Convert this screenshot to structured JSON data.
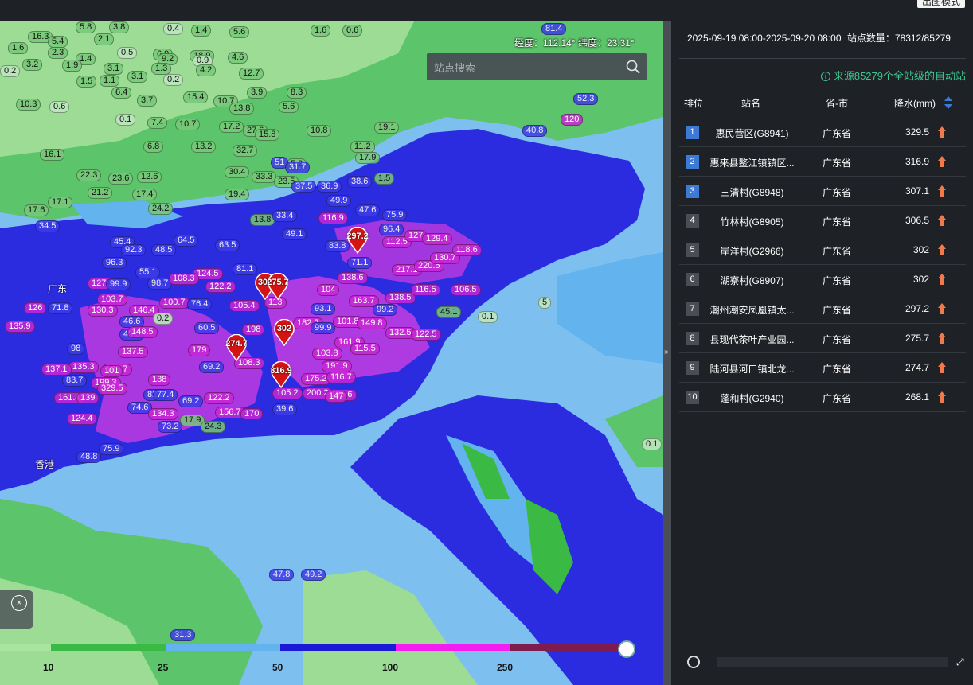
{
  "topbar": {
    "mode_button": "出图模式"
  },
  "map": {
    "coord_readout": "经度：112.14° 纬度：23.31°",
    "search_placeholder": "站点搜索",
    "region_labels": {
      "guangdong": "广东",
      "hongkong": "香港"
    },
    "rain_labels": [
      {
        "t": "5.8",
        "c": "g"
      },
      {
        "t": "3.8",
        "c": "g"
      },
      {
        "t": "0.4",
        "c": "w"
      },
      {
        "t": "1.4",
        "c": "g"
      },
      {
        "t": "5.6",
        "c": "g"
      },
      {
        "t": "1.6",
        "c": "g"
      },
      {
        "t": "0.6",
        "c": "g"
      },
      {
        "t": "16.3",
        "c": "g"
      },
      {
        "t": "5.4",
        "c": "g"
      },
      {
        "t": "2.1",
        "c": "g"
      },
      {
        "t": "1.6",
        "c": "g"
      },
      {
        "t": "2.3",
        "c": "g"
      },
      {
        "t": "0.5",
        "c": "w"
      },
      {
        "t": "6.9",
        "c": "g"
      },
      {
        "t": "18.9",
        "c": "g"
      },
      {
        "t": "4.6",
        "c": "g"
      },
      {
        "t": "3.2",
        "c": "g"
      },
      {
        "t": "1.4",
        "c": "g"
      },
      {
        "t": "9.2",
        "c": "g"
      },
      {
        "t": "0.9",
        "c": "w"
      },
      {
        "t": "3.1",
        "c": "g"
      },
      {
        "t": "1.3",
        "c": "g"
      },
      {
        "t": "4.2",
        "c": "g"
      },
      {
        "t": "12.7",
        "c": "g"
      },
      {
        "t": "0.2",
        "c": "w"
      },
      {
        "t": "1.1",
        "c": "g"
      },
      {
        "t": "3.1",
        "c": "g"
      },
      {
        "t": "1.9",
        "c": "g"
      },
      {
        "t": "1.5",
        "c": "g"
      },
      {
        "t": "0.2",
        "c": "w"
      },
      {
        "t": "6.4",
        "c": "g"
      },
      {
        "t": "3.9",
        "c": "g"
      },
      {
        "t": "8.3",
        "c": "g"
      },
      {
        "t": "15.4",
        "c": "g"
      },
      {
        "t": "10.7",
        "c": "g"
      },
      {
        "t": "10.3",
        "c": "g"
      },
      {
        "t": "0.6",
        "c": "w"
      },
      {
        "t": "3.7",
        "c": "g"
      },
      {
        "t": "13.8",
        "c": "g"
      },
      {
        "t": "5.6",
        "c": "g"
      },
      {
        "t": "0.1",
        "c": "w"
      },
      {
        "t": "7.4",
        "c": "g"
      },
      {
        "t": "17.2",
        "c": "g"
      },
      {
        "t": "27.6",
        "c": "g"
      },
      {
        "t": "15.8",
        "c": "g"
      },
      {
        "t": "10.8",
        "c": "g"
      },
      {
        "t": "19.1",
        "c": "g"
      },
      {
        "t": "10.7",
        "c": "g"
      },
      {
        "t": "6.8",
        "c": "g"
      },
      {
        "t": "13.2",
        "c": "g"
      },
      {
        "t": "32.7",
        "c": "g"
      },
      {
        "t": "11.2",
        "c": "g"
      },
      {
        "t": "5.2",
        "c": "g"
      },
      {
        "t": "1.5",
        "c": "g"
      },
      {
        "t": "16.1",
        "c": "g"
      },
      {
        "t": "30.4",
        "c": "g"
      },
      {
        "t": "51",
        "c": "b"
      },
      {
        "t": "31.7",
        "c": "b"
      },
      {
        "t": "17.9",
        "c": "g"
      },
      {
        "t": "22.3",
        "c": "g"
      },
      {
        "t": "23.6",
        "c": "g"
      },
      {
        "t": "12.6",
        "c": "g"
      },
      {
        "t": "21.2",
        "c": "g"
      },
      {
        "t": "19.4",
        "c": "g"
      },
      {
        "t": "33.3",
        "c": "g"
      },
      {
        "t": "23.5",
        "c": "g"
      },
      {
        "t": "37.5",
        "c": "b"
      },
      {
        "t": "36.9",
        "c": "b"
      },
      {
        "t": "38.6",
        "c": "b"
      },
      {
        "t": "17.1",
        "c": "g"
      },
      {
        "t": "17.4",
        "c": "g"
      },
      {
        "t": "24.2",
        "c": "g"
      },
      {
        "t": "17.6",
        "c": "g"
      },
      {
        "t": "49.9",
        "c": "b"
      },
      {
        "t": "47.6",
        "c": "b"
      },
      {
        "t": "34.5",
        "c": "b"
      },
      {
        "t": "13.8",
        "c": "g"
      },
      {
        "t": "33.4",
        "c": "b"
      },
      {
        "t": "116.9",
        "c": "m"
      },
      {
        "t": "75.9",
        "c": "b"
      },
      {
        "t": "45.4",
        "c": "b"
      },
      {
        "t": "92.3",
        "c": "b"
      },
      {
        "t": "48.5",
        "c": "b"
      },
      {
        "t": "64.5",
        "c": "b"
      },
      {
        "t": "63.5",
        "c": "b"
      },
      {
        "t": "49.1",
        "c": "b"
      },
      {
        "t": "83.8",
        "c": "b"
      },
      {
        "t": "96.4",
        "c": "b"
      },
      {
        "t": "112.5",
        "c": "m"
      },
      {
        "t": "127",
        "c": "m"
      },
      {
        "t": "129.4",
        "c": "m"
      },
      {
        "t": "96.3",
        "c": "b"
      },
      {
        "t": "55.1",
        "c": "b"
      },
      {
        "t": "124.5",
        "c": "m"
      },
      {
        "t": "122.2",
        "c": "m"
      },
      {
        "t": "81.1",
        "c": "b"
      },
      {
        "t": "71.1",
        "c": "b"
      },
      {
        "t": "217.1",
        "c": "m"
      },
      {
        "t": "220.6",
        "c": "m"
      },
      {
        "t": "130.7",
        "c": "m"
      },
      {
        "t": "118.6",
        "c": "m"
      },
      {
        "t": "127.1",
        "c": "m"
      },
      {
        "t": "99.9",
        "c": "b"
      },
      {
        "t": "98.7",
        "c": "b"
      },
      {
        "t": "108.3",
        "c": "m"
      },
      {
        "t": "104",
        "c": "m"
      },
      {
        "t": "138.6",
        "c": "m"
      },
      {
        "t": "106.5",
        "c": "m"
      },
      {
        "t": "103.7",
        "c": "m"
      },
      {
        "t": "105.4",
        "c": "m"
      },
      {
        "t": "113",
        "c": "m"
      },
      {
        "t": "163.7",
        "c": "m"
      },
      {
        "t": "138.5",
        "c": "m"
      },
      {
        "t": "116.5",
        "c": "m"
      },
      {
        "t": "126",
        "c": "m"
      },
      {
        "t": "71.8",
        "c": "b"
      },
      {
        "t": "130.3",
        "c": "m"
      },
      {
        "t": "146.4",
        "c": "m"
      },
      {
        "t": "100.7",
        "c": "m"
      },
      {
        "t": "76.4",
        "c": "b"
      },
      {
        "t": "93.1",
        "c": "b"
      },
      {
        "t": "99.2",
        "c": "b"
      },
      {
        "t": "135.9",
        "c": "m"
      },
      {
        "t": "46.6",
        "c": "b"
      },
      {
        "t": "0.2",
        "c": "w"
      },
      {
        "t": "45.5",
        "c": "b"
      },
      {
        "t": "148.5",
        "c": "m"
      },
      {
        "t": "60.5",
        "c": "b"
      },
      {
        "t": "198",
        "c": "m"
      },
      {
        "t": "182.2",
        "c": "m"
      },
      {
        "t": "99.9",
        "c": "b"
      },
      {
        "t": "101.8",
        "c": "m"
      },
      {
        "t": "149.8",
        "c": "m"
      },
      {
        "t": "132.5",
        "c": "m"
      },
      {
        "t": "98",
        "c": "b"
      },
      {
        "t": "137.5",
        "c": "m"
      },
      {
        "t": "179",
        "c": "m"
      },
      {
        "t": "161.9",
        "c": "m"
      },
      {
        "t": "122.5",
        "c": "m"
      },
      {
        "t": "135.3",
        "c": "m"
      },
      {
        "t": "149.7",
        "c": "m"
      },
      {
        "t": "137.1",
        "c": "m"
      },
      {
        "t": "199.3",
        "c": "m"
      },
      {
        "t": "138",
        "c": "m"
      },
      {
        "t": "69.2",
        "c": "b"
      },
      {
        "t": "108.3",
        "c": "m"
      },
      {
        "t": "103.8",
        "c": "m"
      },
      {
        "t": "115.5",
        "c": "m"
      },
      {
        "t": "191.9",
        "c": "m"
      },
      {
        "t": "166.6",
        "c": "m"
      },
      {
        "t": "101",
        "c": "m"
      },
      {
        "t": "83.7",
        "c": "b"
      },
      {
        "t": "82.3",
        "c": "b"
      },
      {
        "t": "175.2",
        "c": "m"
      },
      {
        "t": "116.7",
        "c": "m"
      },
      {
        "t": "161.4",
        "c": "m"
      },
      {
        "t": "139",
        "c": "m"
      },
      {
        "t": "329.5",
        "c": "m"
      },
      {
        "t": "77.4",
        "c": "b"
      },
      {
        "t": "69.2",
        "c": "b"
      },
      {
        "t": "122.2",
        "c": "m"
      },
      {
        "t": "105.2",
        "c": "m"
      },
      {
        "t": "200.2",
        "c": "m"
      },
      {
        "t": "147",
        "c": "m"
      },
      {
        "t": "74.6",
        "c": "b"
      },
      {
        "t": "39.6",
        "c": "b"
      },
      {
        "t": "134.3",
        "c": "m"
      },
      {
        "t": "156.7",
        "c": "m"
      },
      {
        "t": "170",
        "c": "m"
      },
      {
        "t": "124.4",
        "c": "m"
      },
      {
        "t": "73.2",
        "c": "b"
      },
      {
        "t": "17.9",
        "c": "g"
      },
      {
        "t": "24.3",
        "c": "g"
      },
      {
        "t": "75.9",
        "c": "b"
      },
      {
        "t": "48.8",
        "c": "b"
      },
      {
        "t": "0.1",
        "c": "w"
      },
      {
        "t": "5",
        "c": "w"
      },
      {
        "t": "0.1",
        "c": "w"
      },
      {
        "t": "45.1",
        "c": "g"
      },
      {
        "t": "47.8",
        "c": "b"
      },
      {
        "t": "49.2",
        "c": "b"
      },
      {
        "t": "31.3",
        "c": "b"
      },
      {
        "t": "81.4",
        "c": "b"
      },
      {
        "t": "52.3",
        "c": "b"
      },
      {
        "t": "40.8",
        "c": "b"
      },
      {
        "t": "120",
        "c": "m"
      }
    ],
    "pins": [
      "297.2",
      "302",
      "275.7",
      "302",
      "274.7",
      "316.9"
    ],
    "legend": {
      "ticks": [
        "10",
        "25",
        "50",
        "100",
        "250"
      ]
    }
  },
  "colors": {
    "legend_bands": [
      "#a8e6a0",
      "#3aba45",
      "#62b3ee",
      "#1a1ad6",
      "#f31df0",
      "#7e1c50"
    ],
    "accent_green": "#3dc58f",
    "rank_blue": "#3d7ad6",
    "arrow": "#f07a4c"
  },
  "panel": {
    "period": "2025-09-19 08:00-2025-09-20 08:00",
    "station_count": "站点数量：78312/85279",
    "source_note": "来源85279个全站级的自动站",
    "headers": {
      "rank": "排位",
      "station": "站名",
      "province": "省-市",
      "rain": "降水(mm)"
    },
    "rows": [
      {
        "rank": "1",
        "name": "惠民营区(G8941)",
        "prov": "广东省",
        "val": "329.5"
      },
      {
        "rank": "2",
        "name": "惠来县鳌江镇镇区...",
        "prov": "广东省",
        "val": "316.9"
      },
      {
        "rank": "3",
        "name": "三清村(G8948)",
        "prov": "广东省",
        "val": "307.1"
      },
      {
        "rank": "4",
        "name": "竹林村(G8905)",
        "prov": "广东省",
        "val": "306.5"
      },
      {
        "rank": "5",
        "name": "岸洋村(G2966)",
        "prov": "广东省",
        "val": "302"
      },
      {
        "rank": "6",
        "name": "湖寮村(G8907)",
        "prov": "广东省",
        "val": "302"
      },
      {
        "rank": "7",
        "name": "潮州潮安凤凰镇太...",
        "prov": "广东省",
        "val": "297.2"
      },
      {
        "rank": "8",
        "name": "县现代茶叶产业园...",
        "prov": "广东省",
        "val": "275.7"
      },
      {
        "rank": "9",
        "name": "陆河县河口镇北龙...",
        "prov": "广东省",
        "val": "274.7"
      },
      {
        "rank": "10",
        "name": "蓬和村(G2940)",
        "prov": "广东省",
        "val": "268.1"
      }
    ]
  }
}
